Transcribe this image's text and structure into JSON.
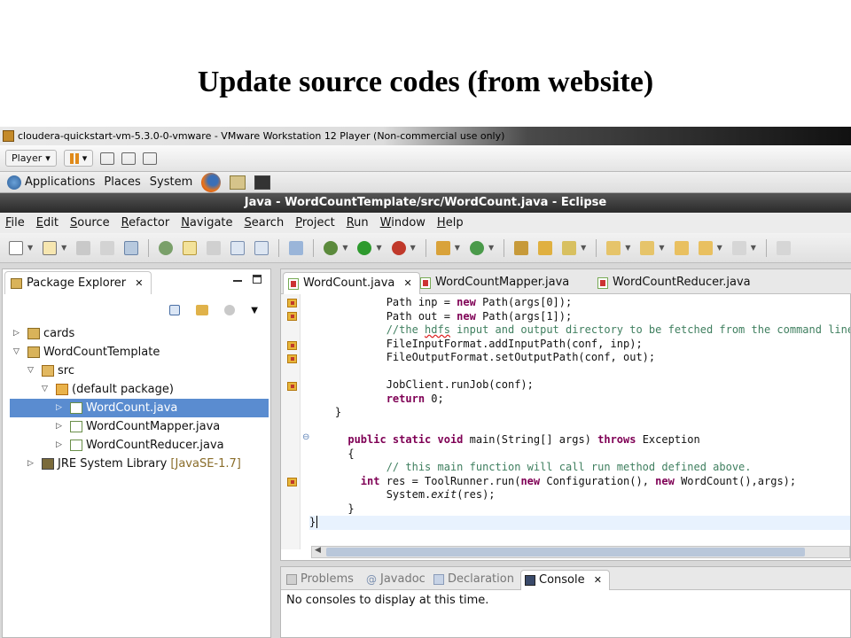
{
  "slide": {
    "title": "Update source codes (from website)"
  },
  "vmware": {
    "window_title": "cloudera-quickstart-vm-5.3.0-0-vmware - VMware Workstation 12 Player (Non-commercial use only)",
    "player_menu": "Player"
  },
  "gnome_panel": {
    "applications": "Applications",
    "places": "Places",
    "system": "System"
  },
  "eclipse": {
    "window_title": "Java - WordCountTemplate/src/WordCount.java - Eclipse",
    "menu": [
      "File",
      "Edit",
      "Source",
      "Refactor",
      "Navigate",
      "Search",
      "Project",
      "Run",
      "Window",
      "Help"
    ]
  },
  "package_explorer": {
    "tab_label": "Package Explorer",
    "tree": [
      {
        "label": "cards",
        "depth": 0,
        "expanded": false
      },
      {
        "label": "WordCountTemplate",
        "depth": 0,
        "expanded": true
      },
      {
        "label": "src",
        "depth": 1,
        "expanded": true
      },
      {
        "label": "(default package)",
        "depth": 2,
        "expanded": true
      },
      {
        "label": "WordCount.java",
        "depth": 3,
        "expanded": false,
        "selected": true
      },
      {
        "label": "WordCountMapper.java",
        "depth": 3,
        "expanded": false
      },
      {
        "label": "WordCountReducer.java",
        "depth": 3,
        "expanded": false
      },
      {
        "label": "JRE System Library",
        "suffix": "[JavaSE-1.7]",
        "depth": 1,
        "expanded": false
      }
    ]
  },
  "editor": {
    "tabs": [
      {
        "label": "WordCount.java",
        "active": true
      },
      {
        "label": "WordCountMapper.java",
        "active": false
      },
      {
        "label": "WordCountReducer.java",
        "active": false
      }
    ],
    "code_lines": [
      "            Path inp = new Path(args[0]);",
      "            Path out = new Path(args[1]);",
      "            //the hdfs input and output directory to be fetched from the command line",
      "            FileInputFormat.addInputPath(conf, inp);",
      "            FileOutputFormat.setOutputPath(conf, out);",
      "",
      "            JobClient.runJob(conf);",
      "            return 0;",
      "    }",
      "",
      "      public static void main(String[] args) throws Exception",
      "      {",
      "            // this main function will call run method defined above.",
      "        int res = ToolRunner.run(new Configuration(), new WordCount(),args);",
      "            System.exit(res);",
      "      }",
      "}"
    ]
  },
  "bottom_panel": {
    "tabs": [
      {
        "label": "Problems",
        "active": false
      },
      {
        "label": "Javadoc",
        "active": false
      },
      {
        "label": "Declaration",
        "active": false
      },
      {
        "label": "Console",
        "active": true
      }
    ],
    "message": "No consoles to display at this time."
  },
  "colors": {
    "selection": "#5a8cd0",
    "keyword": "#7f0055",
    "comment": "#3f7f5f"
  }
}
